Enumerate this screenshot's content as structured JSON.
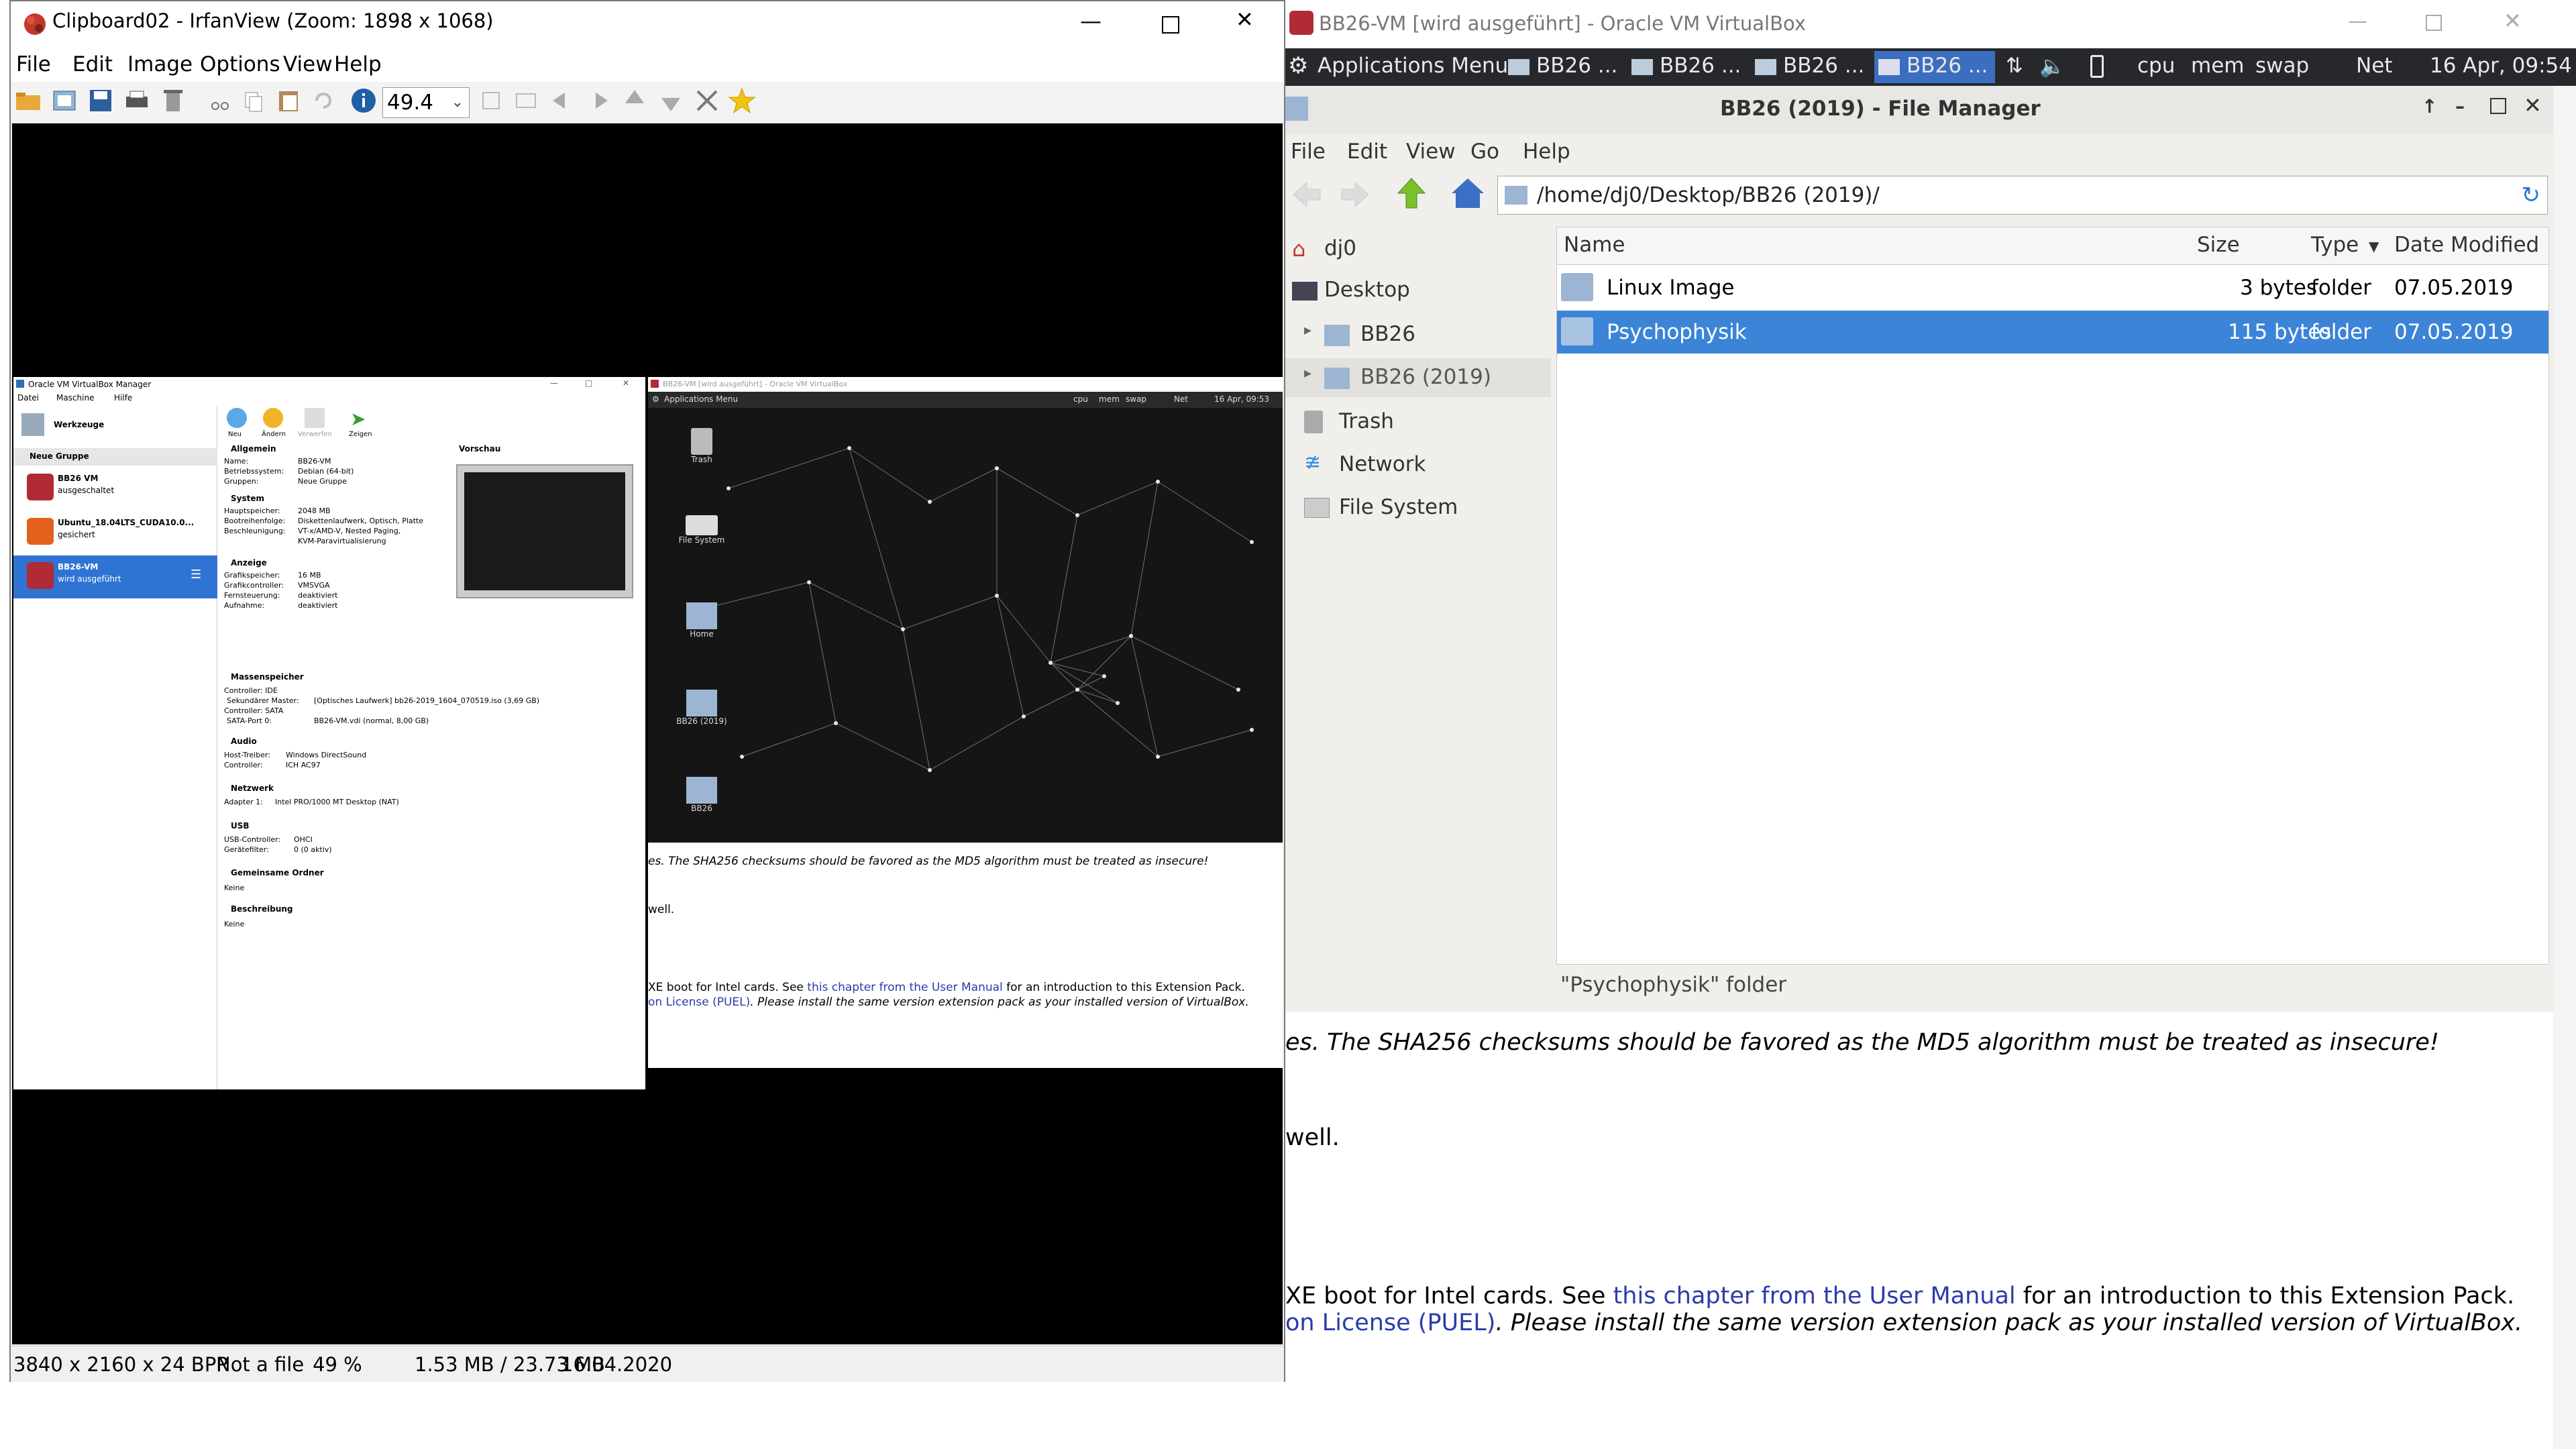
{
  "irfanview": {
    "title": "Clipboard02 - IrfanView (Zoom: 1898 x 1068)",
    "menu": [
      "File",
      "Edit",
      "Image",
      "Options",
      "View",
      "Help"
    ],
    "zoom_value": "49.4",
    "status": {
      "dimensions": "3840 x 2160 x 24 BPP",
      "file": "Not a file",
      "zoom": "49 %",
      "memory": "1.53 MB / 23.73 MB",
      "date": "16.04.2020"
    }
  },
  "vbox_manager": {
    "title": "Oracle VM VirtualBox Manager",
    "menu": [
      "Datei",
      "Maschine",
      "Hilfe"
    ],
    "tools_label": "Werkzeuge",
    "toolbar": [
      "Neu",
      "Ändern",
      "Verwerfen",
      "Zeigen"
    ],
    "group": "Neue Gruppe",
    "vms": [
      {
        "name": "BB26 VM",
        "state": "ausgeschaltet"
      },
      {
        "name": "Ubuntu_18.04LTS_CUDA10.0...",
        "state": "gesichert"
      },
      {
        "name": "BB26-VM",
        "state": "wird ausgeführt"
      }
    ],
    "preview_label": "Vorschau",
    "sections": [
      {
        "title": "Allgemein",
        "rows": [
          [
            "Name:",
            "BB26-VM"
          ],
          [
            "Betriebssystem:",
            "Debian (64-bit)"
          ],
          [
            "Gruppen:",
            "Neue Gruppe"
          ]
        ]
      },
      {
        "title": "System",
        "rows": [
          [
            "Hauptspeicher:",
            "2048 MB"
          ],
          [
            "Bootreihenfolge:",
            "Diskettenlaufwerk, Optisch, Platte"
          ],
          [
            "Beschleunigung:",
            "VT-x/AMD-V, Nested Paging,"
          ],
          [
            "",
            "KVM-Paravirtualisierung"
          ]
        ]
      },
      {
        "title": "Anzeige",
        "rows": [
          [
            "Grafikspeicher:",
            "16 MB"
          ],
          [
            "Grafikcontroller:",
            "VMSVGA"
          ],
          [
            "Fernsteuerung:",
            "deaktiviert"
          ],
          [
            "Aufnahme:",
            "deaktiviert"
          ]
        ]
      },
      {
        "title": "Massenspeicher",
        "rows": [
          [
            "Controller: IDE",
            ""
          ],
          [
            "Sekundärer Master:",
            "[Optisches Laufwerk] bb26-2019_1604_070519.iso (3,69 GB)"
          ],
          [
            "Controller: SATA",
            ""
          ],
          [
            "SATA-Port 0:",
            "BB26-VM.vdi (normal, 8,00 GB)"
          ]
        ]
      },
      {
        "title": "Audio",
        "rows": [
          [
            "Host-Treiber:",
            "Windows DirectSound"
          ],
          [
            "Controller:",
            "ICH AC97"
          ]
        ]
      },
      {
        "title": "Netzwerk",
        "rows": [
          [
            "Adapter 1:",
            "Intel PRO/1000 MT Desktop (NAT)"
          ]
        ]
      },
      {
        "title": "USB",
        "rows": [
          [
            "USB-Controller:",
            "OHCI"
          ],
          [
            "Gerätefilter:",
            "0 (0 aktiv)"
          ]
        ]
      },
      {
        "title": "Gemeinsame Ordner",
        "rows": [
          [
            "Keine",
            ""
          ]
        ]
      },
      {
        "title": "Beschreibung",
        "rows": [
          [
            "Keine",
            ""
          ]
        ]
      }
    ]
  },
  "mini_vm": {
    "title": "BB26-VM [wird ausgeführt] - Oracle VM VirtualBox",
    "panel_app": "Applications Menu",
    "panel_items": [
      "cpu",
      "mem",
      "swap",
      "Net"
    ],
    "panel_clock": "16 Apr, 09:53",
    "desktop_icons": [
      "Trash",
      "File System",
      "Home",
      "BB26 (2019)",
      "BB26"
    ],
    "web_line1": "es. The SHA256 checksums should be favored as the MD5 algorithm must be treated as insecure!",
    "web_line2": "well.",
    "web_line3a": "XE boot for Intel cards. See ",
    "web_line3b": "this chapter from the User Manual",
    "web_line3c": " for an introduction to this Extension Pack.",
    "web_line4a": "on License (PUEL)",
    "web_line4b": ". Please install the same version extension pack as your installed version of VirtualBox."
  },
  "vm_window": {
    "title": "BB26-VM [wird ausgeführt] - Oracle VM VirtualBox",
    "panel": {
      "app_menu": "Applications Menu",
      "tasks": [
        "BB26 ...",
        "BB26 ...",
        "BB26 ...",
        "BB26 ..."
      ],
      "items": [
        "cpu",
        "mem",
        "swap",
        "Net"
      ],
      "clock": "16 Apr, 09:54"
    }
  },
  "file_manager": {
    "title": "BB26 (2019) - File Manager",
    "menu": [
      "File",
      "Edit",
      "View",
      "Go",
      "Help"
    ],
    "location": "/home/dj0/Desktop/BB26 (2019)/",
    "sidebar": [
      {
        "label": "dj0",
        "icon": "home-icon"
      },
      {
        "label": "Desktop",
        "icon": "desktop-icon"
      },
      {
        "label": "BB26",
        "icon": "folder-icon"
      },
      {
        "label": "BB26 (2019)",
        "icon": "folder-icon"
      },
      {
        "label": "Trash",
        "icon": "trash-icon"
      },
      {
        "label": "Network",
        "icon": "network-icon"
      },
      {
        "label": "File System",
        "icon": "drive-icon"
      }
    ],
    "columns": [
      "Name",
      "Size",
      "Type",
      "Date Modified"
    ],
    "rows": [
      {
        "name": "Linux Image",
        "size": "3 bytes",
        "type": "folder",
        "date": "07.05.2019"
      },
      {
        "name": "Psychophysik",
        "size": "115 bytes",
        "type": "folder",
        "date": "07.05.2019"
      }
    ],
    "status": "\"Psychophysik\" folder"
  },
  "web_page": {
    "line1": "es. The SHA256 checksums should be favored as the MD5 algorithm must be treated as insecure!",
    "line2": "well.",
    "line3a": "XE boot for Intel cards. See ",
    "line3b": "this chapter from the User Manual",
    "line3c": " for an introduction to this Extension Pack.",
    "line4a": "on License (PUEL)",
    "line4b": ". Please install the same version extension pack as your installed version of VirtualBox."
  }
}
